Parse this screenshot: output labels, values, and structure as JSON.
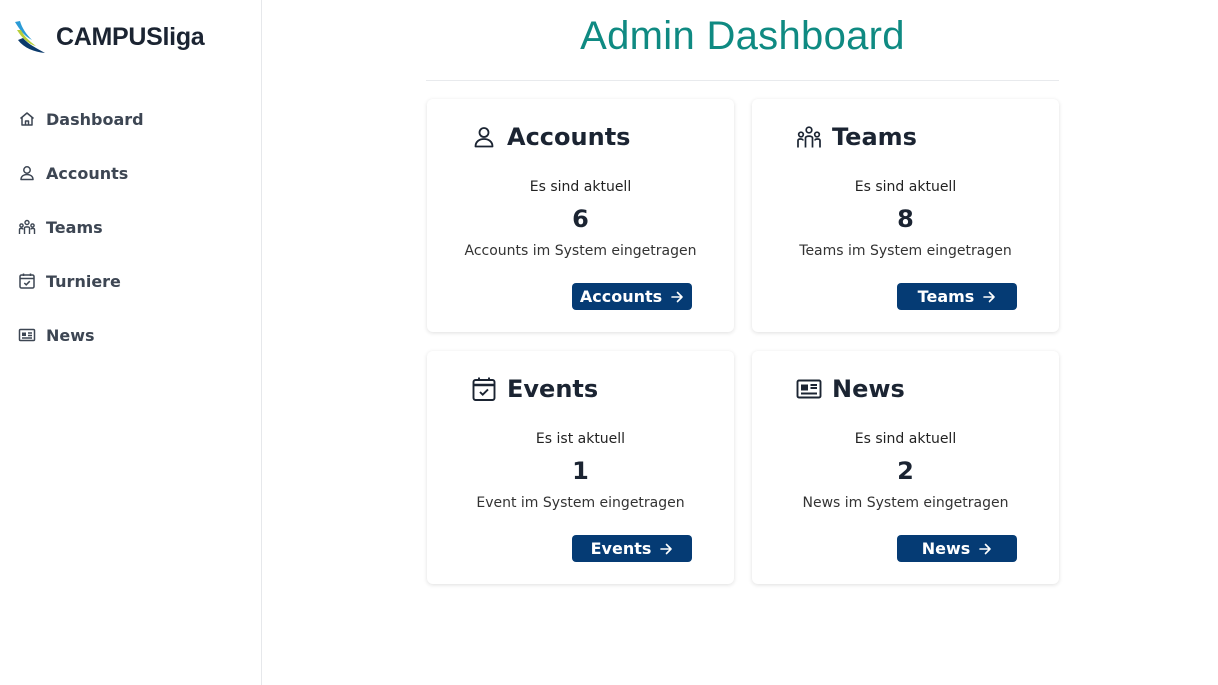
{
  "brand": {
    "name": "CAMPUSliga"
  },
  "sidebar": {
    "items": [
      {
        "label": "Dashboard",
        "icon": "home-icon"
      },
      {
        "label": "Accounts",
        "icon": "user-icon"
      },
      {
        "label": "Teams",
        "icon": "team-icon"
      },
      {
        "label": "Turniere",
        "icon": "calendar-check-icon"
      },
      {
        "label": "News",
        "icon": "newspaper-icon"
      }
    ]
  },
  "main": {
    "title": "Admin Dashboard",
    "cards": [
      {
        "title": "Accounts",
        "pre": "Es sind aktuell",
        "count": "6",
        "post": "Accounts im System eingetragen",
        "button": "Accounts",
        "icon": "user-icon"
      },
      {
        "title": "Teams",
        "pre": "Es sind aktuell",
        "count": "8",
        "post": "Teams im System eingetragen",
        "button": "Teams",
        "icon": "team-icon"
      },
      {
        "title": "Events",
        "pre": "Es ist aktuell",
        "count": "1",
        "post": "Event im System eingetragen",
        "button": "Events",
        "icon": "calendar-check-icon"
      },
      {
        "title": "News",
        "pre": "Es sind aktuell",
        "count": "2",
        "post": "News im System eingetragen",
        "button": "News",
        "icon": "newspaper-icon"
      }
    ]
  },
  "colors": {
    "accent": "#0f8a82",
    "button": "#053b74",
    "sidebar_text": "#3d4653"
  }
}
